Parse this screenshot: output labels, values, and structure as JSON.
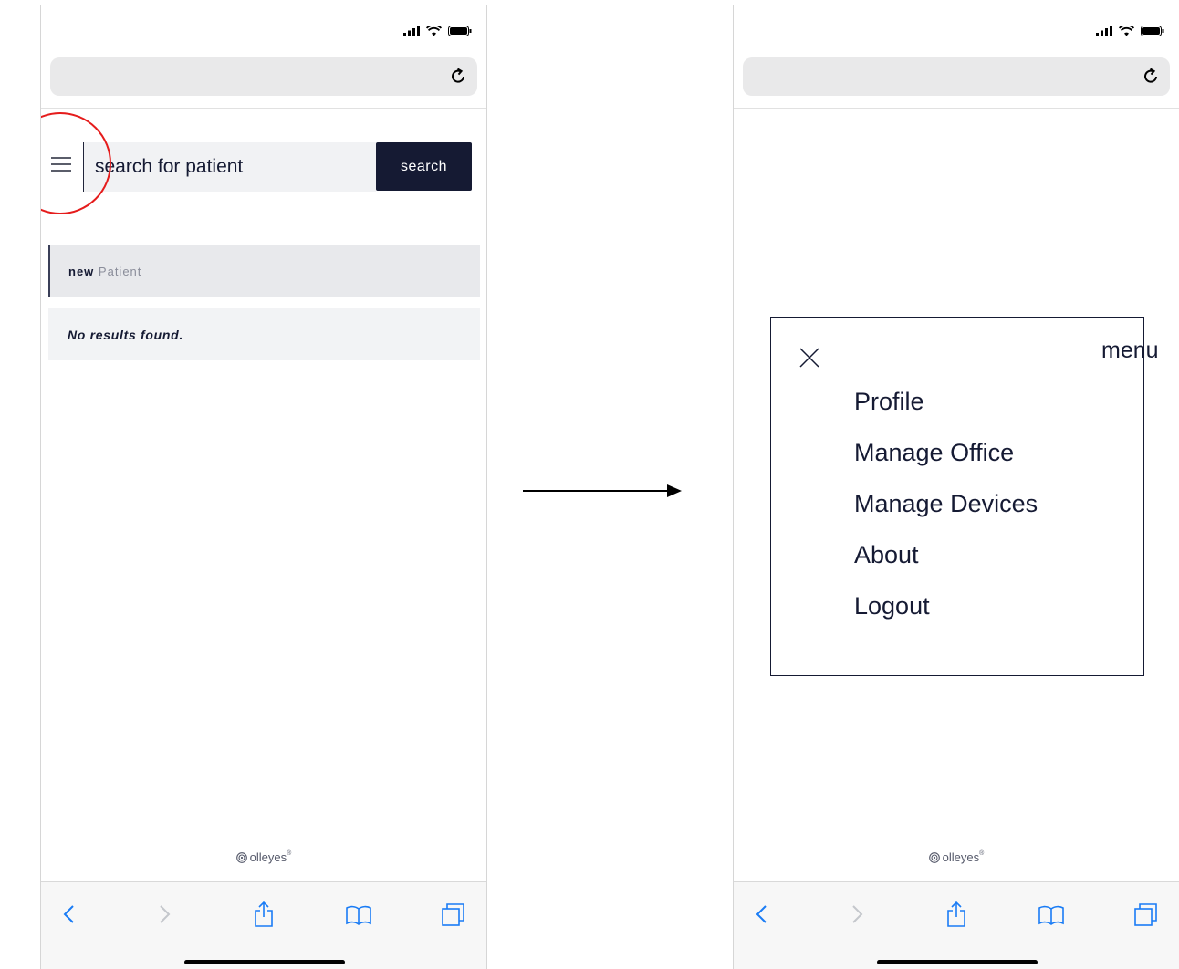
{
  "left_screen": {
    "search": {
      "placeholder": "search for patient",
      "button_label": "search"
    },
    "new_patient": {
      "bold": "new",
      "label": "Patient"
    },
    "no_results": "No results found.",
    "footer_brand": "olleyes",
    "footer_mark": "®"
  },
  "right_screen": {
    "menu": {
      "title": "menu",
      "items": [
        "Profile",
        "Manage Office",
        "Manage Devices",
        "About",
        "Logout"
      ]
    },
    "footer_brand": "olleyes",
    "footer_mark": "®"
  },
  "icons": {
    "status": [
      "signal-icon",
      "wifi-icon",
      "battery-icon"
    ],
    "urlbar": "reload-icon",
    "toolbar": [
      "back-icon",
      "forward-icon",
      "share-icon",
      "bookmarks-icon",
      "tabs-icon"
    ],
    "menu_close": "close-icon",
    "menu_toggle": "hamburger-icon"
  },
  "colors": {
    "primary": "#151a33",
    "annotation": "#e51c1c",
    "ios_blue": "#1a7cf5",
    "field_bg": "#f1f2f4"
  }
}
